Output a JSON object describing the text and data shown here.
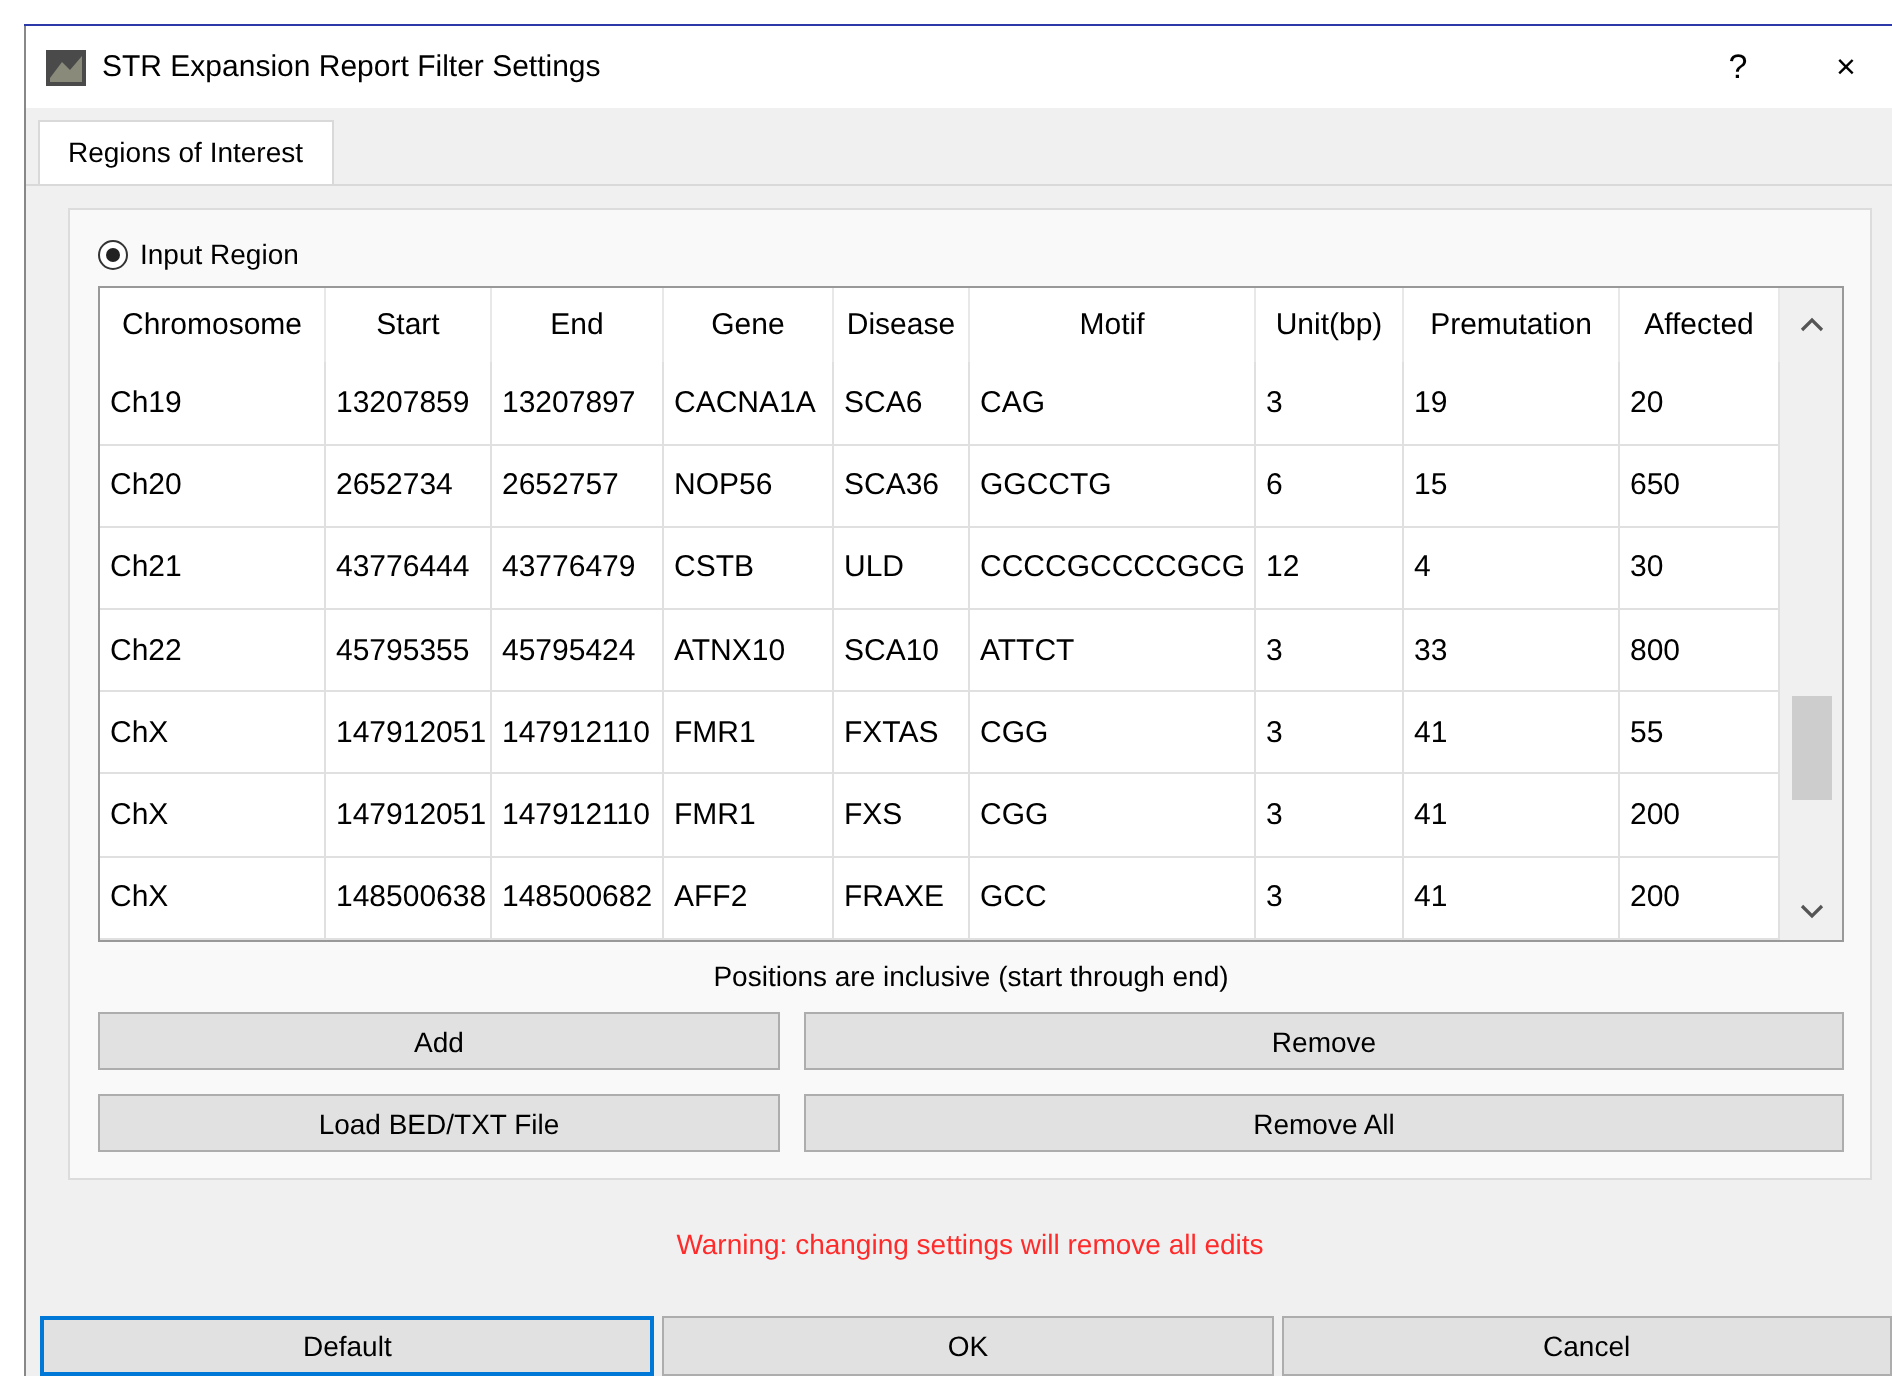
{
  "window": {
    "title": "STR Expansion Report Filter Settings",
    "help": "?",
    "close": "×"
  },
  "tabs": [
    {
      "label": "Regions of Interest",
      "selected": true
    }
  ],
  "radio": {
    "label": "Input Region",
    "selected": true
  },
  "table": {
    "columns": [
      "Chromosome",
      "Start",
      "End",
      "Gene",
      "Disease",
      "Motif",
      "Unit(bp)",
      "Premutation",
      "Affected"
    ],
    "rows": [
      [
        "Ch19",
        "13207859",
        "13207897",
        "CACNA1A",
        "SCA6",
        "CAG",
        "3",
        "19",
        "20"
      ],
      [
        "Ch20",
        "2652734",
        "2652757",
        "NOP56",
        "SCA36",
        "GGCCTG",
        "6",
        "15",
        "650"
      ],
      [
        "Ch21",
        "43776444",
        "43776479",
        "CSTB",
        "ULD",
        "CCCCGCCCCGCG",
        "12",
        "4",
        "30"
      ],
      [
        "Ch22",
        "45795355",
        "45795424",
        "ATNX10",
        "SCA10",
        "ATTCT",
        "3",
        "33",
        "800"
      ],
      [
        "ChX",
        "147912051",
        "147912110",
        "FMR1",
        "FXTAS",
        "CGG",
        "3",
        "41",
        "55"
      ],
      [
        "ChX",
        "147912051",
        "147912110",
        "FMR1",
        "FXS",
        "CGG",
        "3",
        "41",
        "200"
      ],
      [
        "ChX",
        "148500638",
        "148500682",
        "AFF2",
        "FRAXE",
        "GCC",
        "3",
        "41",
        "200"
      ]
    ]
  },
  "caption": "Positions are inclusive (start through end)",
  "actions": [
    [
      "Add",
      "Remove"
    ],
    [
      "Load BED/TXT File",
      "Remove All"
    ]
  ],
  "warning": "Warning: changing settings will remove all edits",
  "buttons": [
    {
      "label": "Default",
      "focused": true
    },
    {
      "label": "OK",
      "focused": false
    },
    {
      "label": "Cancel",
      "focused": false
    }
  ]
}
